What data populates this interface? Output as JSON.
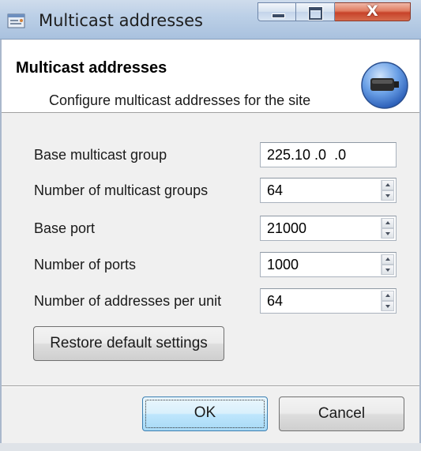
{
  "window": {
    "title": "Multicast addresses",
    "close_glyph": "X"
  },
  "header": {
    "title": "Multicast addresses",
    "subtitle": "Configure multicast addresses for the site",
    "icon": "network-adapter-icon"
  },
  "form": {
    "fields": [
      {
        "label": "Base multicast group",
        "value": "225.10 .0  .0",
        "control": "ip-address"
      },
      {
        "label": "Number of multicast groups",
        "value": "64",
        "control": "spinner"
      },
      {
        "label": "Base port",
        "value": "21000",
        "control": "spinner"
      },
      {
        "label": "Number of ports",
        "value": "1000",
        "control": "spinner"
      },
      {
        "label": "Number of addresses per unit",
        "value": "64",
        "control": "spinner"
      }
    ]
  },
  "buttons": {
    "restore": "Restore default settings",
    "ok": "OK",
    "cancel": "Cancel"
  },
  "colors": {
    "titlebar": "#bcd0e7",
    "close_button": "#c7432a",
    "header_background": "#ffffff",
    "ok_focus_border": "#3c7fb1"
  }
}
